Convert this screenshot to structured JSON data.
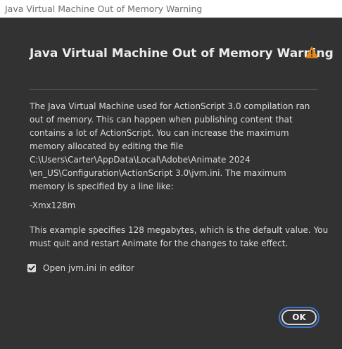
{
  "window": {
    "title": "Java Virtual Machine Out of Memory Warning"
  },
  "dialog": {
    "heading": "Java Virtual Machine Out of Memory Warning",
    "icon": "warning-icon",
    "accent_color": "#e68619",
    "paragraph1_lines": [
      "The Java Virtual Machine used for ActionScript 3.0 compilation ran",
      "out of memory. This can happen when publishing content that",
      "contains a lot of ActionScript. You can increase the maximum",
      "memory allocated by editing the file",
      "C:\\Users\\Carter\\AppData\\Local\\Adobe\\Animate 2024",
      "\\en_US\\Configuration\\ActionScript 3.0\\jvm.ini. The maximum",
      "memory is specified by a line like:"
    ],
    "example": "-Xmx128m",
    "paragraph2_lines": [
      "This example specifies 128 megabytes, which is the default value. You",
      "must quit and restart Animate for the changes to take effect."
    ],
    "checkbox": {
      "label": "Open jvm.ini in editor",
      "checked": true
    },
    "ok_label": "OK",
    "focus_color": "#3f76d0"
  }
}
